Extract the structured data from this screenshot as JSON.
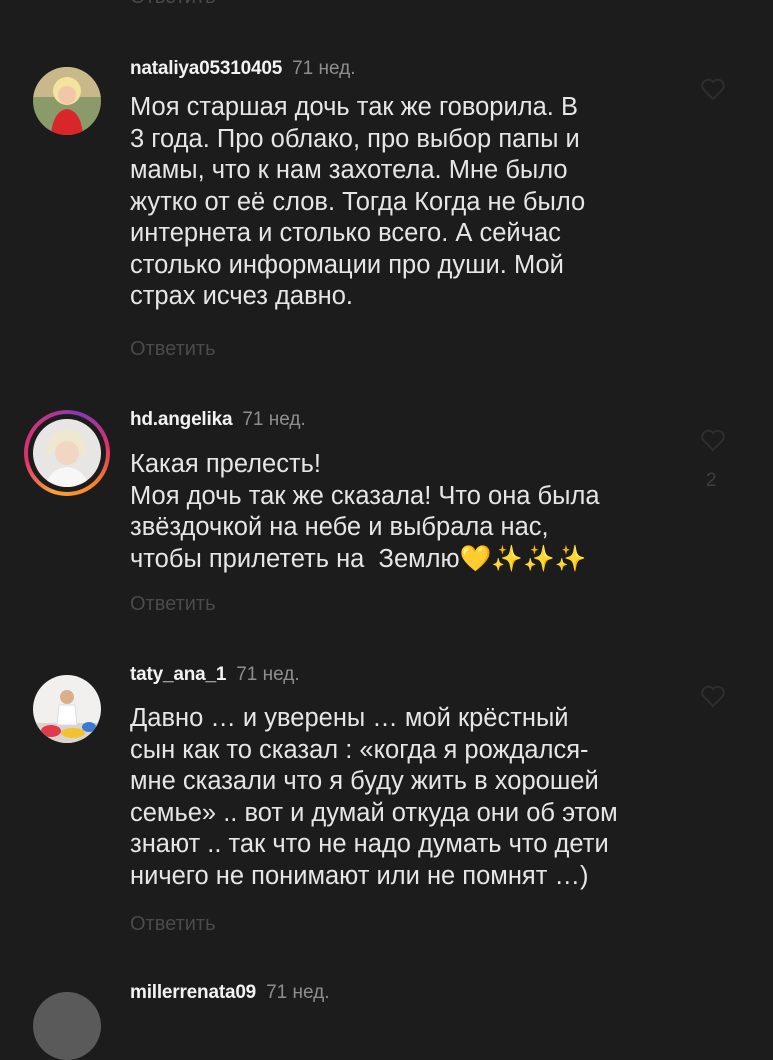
{
  "reply_label": "Ответить",
  "comments": [
    {
      "username": "nataliya05310405",
      "time": "71 нед.",
      "text": "Моя старшая дочь так же говорила. В\n3 года. Про облако, про выбор папы и\nмамы, что к нам захотела. Мне было\nжутко от её слов. Тогда Когда не было\nинтернета и столько всего. А сейчас\nстолько информации про души. Мой\nстрах исчез давно."
    },
    {
      "username": "hd.angelika",
      "time": "71 нед.",
      "text": "Какая прелесть!\nМоя дочь так же сказала! Что она была\nзвёздочкой на небе и выбрала нас,\nчтобы прилететь на  Землю💛✨✨✨",
      "likes": "2"
    },
    {
      "username": "taty_ana_1",
      "time": "71 нед.",
      "text": "Давно … и уверены … мой крёстный\nсын как то сказал : «когда я рождался-\nмне сказали что я буду жить в хорошей\nсемье» .. вот и думай откуда они об этом\nзнают .. так что не надо думать что дети\nничего не понимают или не помнят …)"
    },
    {
      "username": "millerrenata09",
      "time": "71 нед."
    }
  ],
  "colors": {
    "background": "#1c1c1d",
    "text": "#e6e6e6",
    "muted": "#8e8e90",
    "reply": "#4a4a4c",
    "story_ring": "#e1306c"
  }
}
